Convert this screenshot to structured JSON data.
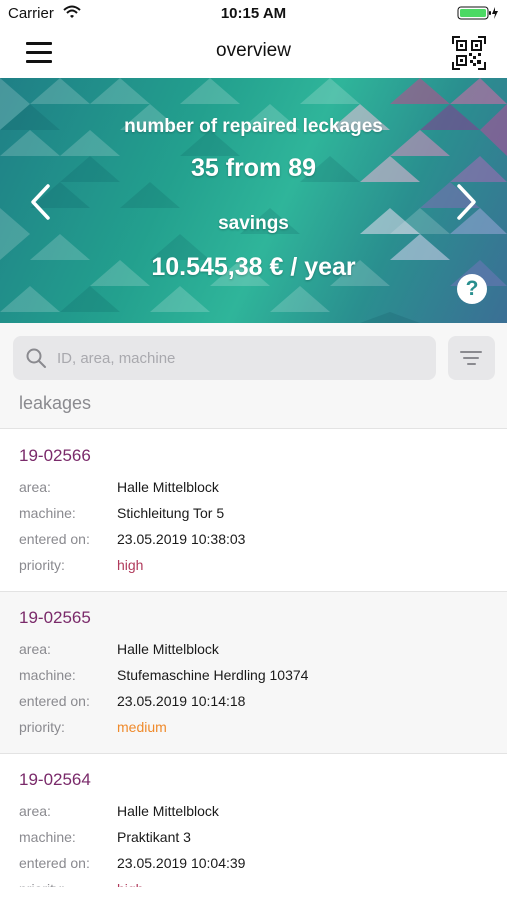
{
  "status_bar": {
    "carrier": "Carrier",
    "time": "10:15 AM"
  },
  "nav": {
    "title": "overview",
    "menu_icon": "hamburger-menu-icon",
    "qr_icon": "qr-code-icon"
  },
  "banner": {
    "label1": "number of repaired leckages",
    "value1": "35 from 89",
    "label2": "savings",
    "value2": "10.545,38 € / year",
    "help": "?"
  },
  "search": {
    "placeholder": "ID, area, machine",
    "value": ""
  },
  "section_label": "leakages",
  "field_labels": {
    "area": "area:",
    "machine": "machine:",
    "entered_on": "entered on:",
    "priority": "priority:"
  },
  "items": [
    {
      "id": "19-02566",
      "area": "Halle Mittelblock",
      "machine": "Stichleitung Tor 5",
      "entered_on": "23.05.2019 10:38:03",
      "priority": "high"
    },
    {
      "id": "19-02565",
      "area": "Halle Mittelblock",
      "machine": "Stufemaschine Herdling 10374",
      "entered_on": "23.05.2019 10:14:18",
      "priority": "medium"
    },
    {
      "id": "19-02564",
      "area": "Halle Mittelblock",
      "machine": "Praktikant 3",
      "entered_on": "23.05.2019 10:04:39",
      "priority": "high"
    }
  ],
  "colors": {
    "id": "#7a2a6a",
    "high": "#b03a5b",
    "medium": "#ef8a2b",
    "banner": "#23a08e"
  }
}
